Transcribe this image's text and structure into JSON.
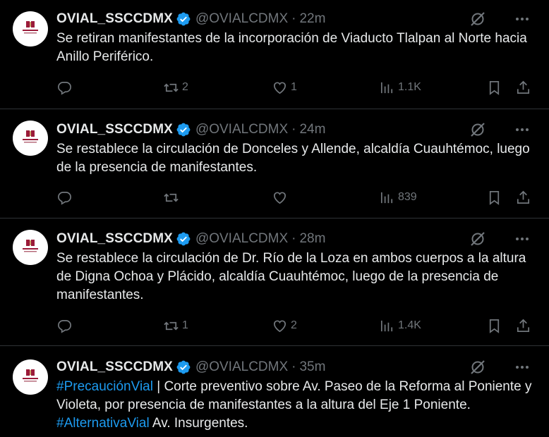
{
  "tweets": [
    {
      "name": "OVIAL_SSCCDMX",
      "handle": "@OVIALCDMX",
      "separator": "·",
      "time": "22m",
      "text_parts": [
        {
          "text": "Se retiran manifestantes de la incorporación de Viaducto Tlalpan al Norte hacia Anillo Periférico.",
          "type": "text"
        }
      ],
      "replies": "",
      "retweets": "2",
      "likes": "1",
      "views": "1.1K"
    },
    {
      "name": "OVIAL_SSCCDMX",
      "handle": "@OVIALCDMX",
      "separator": "·",
      "time": "24m",
      "text_parts": [
        {
          "text": "Se restablece la circulación de Donceles y Allende, alcaldía Cuauhtémoc, luego de la presencia de manifestantes.",
          "type": "text"
        }
      ],
      "replies": "",
      "retweets": "",
      "likes": "",
      "views": "839"
    },
    {
      "name": "OVIAL_SSCCDMX",
      "handle": "@OVIALCDMX",
      "separator": "·",
      "time": "28m",
      "text_parts": [
        {
          "text": "Se restablece la circulación de Dr. Río de la Loza en ambos cuerpos a la altura de Digna Ochoa y Plácido, alcaldía Cuauhtémoc, luego de la presencia de manifestantes.",
          "type": "text"
        }
      ],
      "replies": "",
      "retweets": "1",
      "likes": "2",
      "views": "1.4K"
    },
    {
      "name": "OVIAL_SSCCDMX",
      "handle": "@OVIALCDMX",
      "separator": "·",
      "time": "35m",
      "text_parts": [
        {
          "text": "#PrecauciónVial",
          "type": "hashtag"
        },
        {
          "text": " | Corte preventivo sobre Av. Paseo de la Reforma al Poniente y Violeta, por presencia de manifestantes a la altura del Eje 1 Poniente. ",
          "type": "text"
        },
        {
          "text": "#AlternativaVial",
          "type": "hashtag"
        },
        {
          "text": " Av. Insurgentes.",
          "type": "text"
        }
      ]
    }
  ],
  "icons": {
    "verified": "verified-badge-icon",
    "grok": "grok-icon",
    "more": "more-icon",
    "reply": "reply-icon",
    "retweet": "retweet-icon",
    "like": "like-icon",
    "views": "views-icon",
    "bookmark": "bookmark-icon",
    "share": "share-icon"
  },
  "colors": {
    "background": "#000000",
    "text": "#e7e9ea",
    "muted": "#71767b",
    "accent": "#1d9bf0",
    "divider": "#2f3336"
  }
}
